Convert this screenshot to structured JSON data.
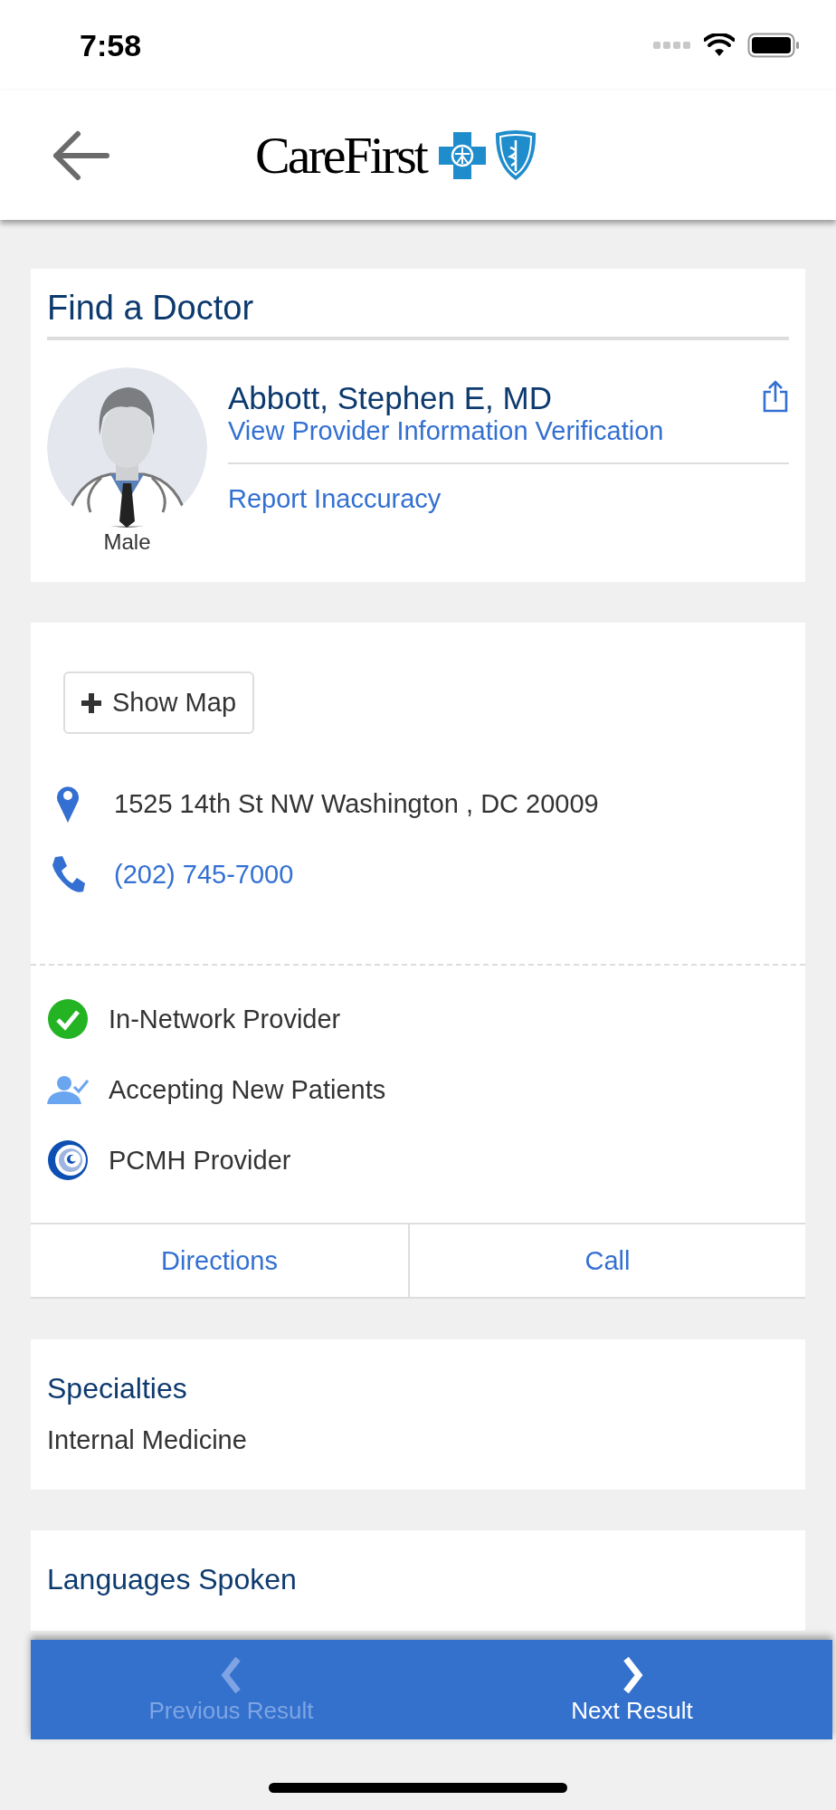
{
  "status_bar": {
    "time": "7:58"
  },
  "header": {
    "logo": "CareFirst"
  },
  "provider_card": {
    "title": "Find a Doctor",
    "gender": "Male",
    "name": "Abbott, Stephen E, MD",
    "verification_link": "View Provider Information Verification",
    "report_link": "Report Inaccuracy"
  },
  "location_card": {
    "map_button": "Show Map",
    "address": "1525 14th St NW Washington , DC 20009",
    "phone": "(202) 745-7000",
    "badges": [
      {
        "kind": "in_network",
        "label": "In-Network Provider"
      },
      {
        "kind": "accepting",
        "label": "Accepting New Patients"
      },
      {
        "kind": "pcmh",
        "label": "PCMH Provider"
      }
    ],
    "actions": [
      "Directions",
      "Call"
    ]
  },
  "sections": [
    {
      "title": "Specialties",
      "value": "Internal Medicine"
    },
    {
      "title": "Languages Spoken"
    }
  ],
  "pager": [
    {
      "kind": "previous",
      "label": "Previous Result",
      "disabled": true
    },
    {
      "kind": "next",
      "label": "Next Result",
      "disabled": false
    }
  ]
}
